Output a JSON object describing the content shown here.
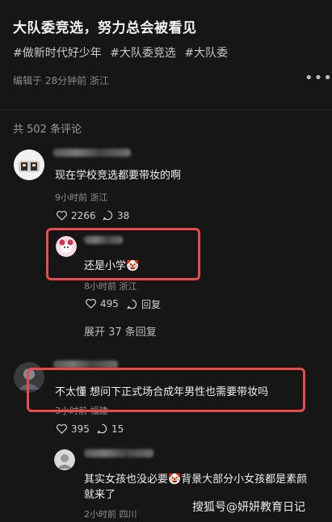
{
  "post": {
    "title": "大队委竞选，努力总会被看见",
    "tags": [
      "#做新时代好少年",
      "#大队委竞选",
      "#大队委"
    ],
    "meta": "编辑于 28分钟前 浙江"
  },
  "comments_count_label": "共 502 条评论",
  "comments": [
    {
      "text": "现在学校竞选都要带妆的啊",
      "time": "9小时前 浙江",
      "likes": "2266",
      "replies": "38",
      "reply": {
        "text": "还是小学🤡",
        "time": "8小时前 浙江",
        "likes": "495",
        "reply_label": "回复"
      },
      "expand_label": "展开 37 条回复"
    },
    {
      "text": "不太懂 想问下正式场合成年男性也需要带妆吗",
      "time": "3小时前 福建",
      "likes": "395",
      "replies": "15"
    },
    {
      "text_line1": "其实女孩也没必要🤡背景大部分小女孩都是素颜",
      "text_line2": "就来了",
      "time": "2小时前 四川"
    }
  ],
  "watermark": "搜狐号@妍妍教育日记",
  "colors": {
    "highlight": "#e94a4a",
    "background": "#161616"
  }
}
